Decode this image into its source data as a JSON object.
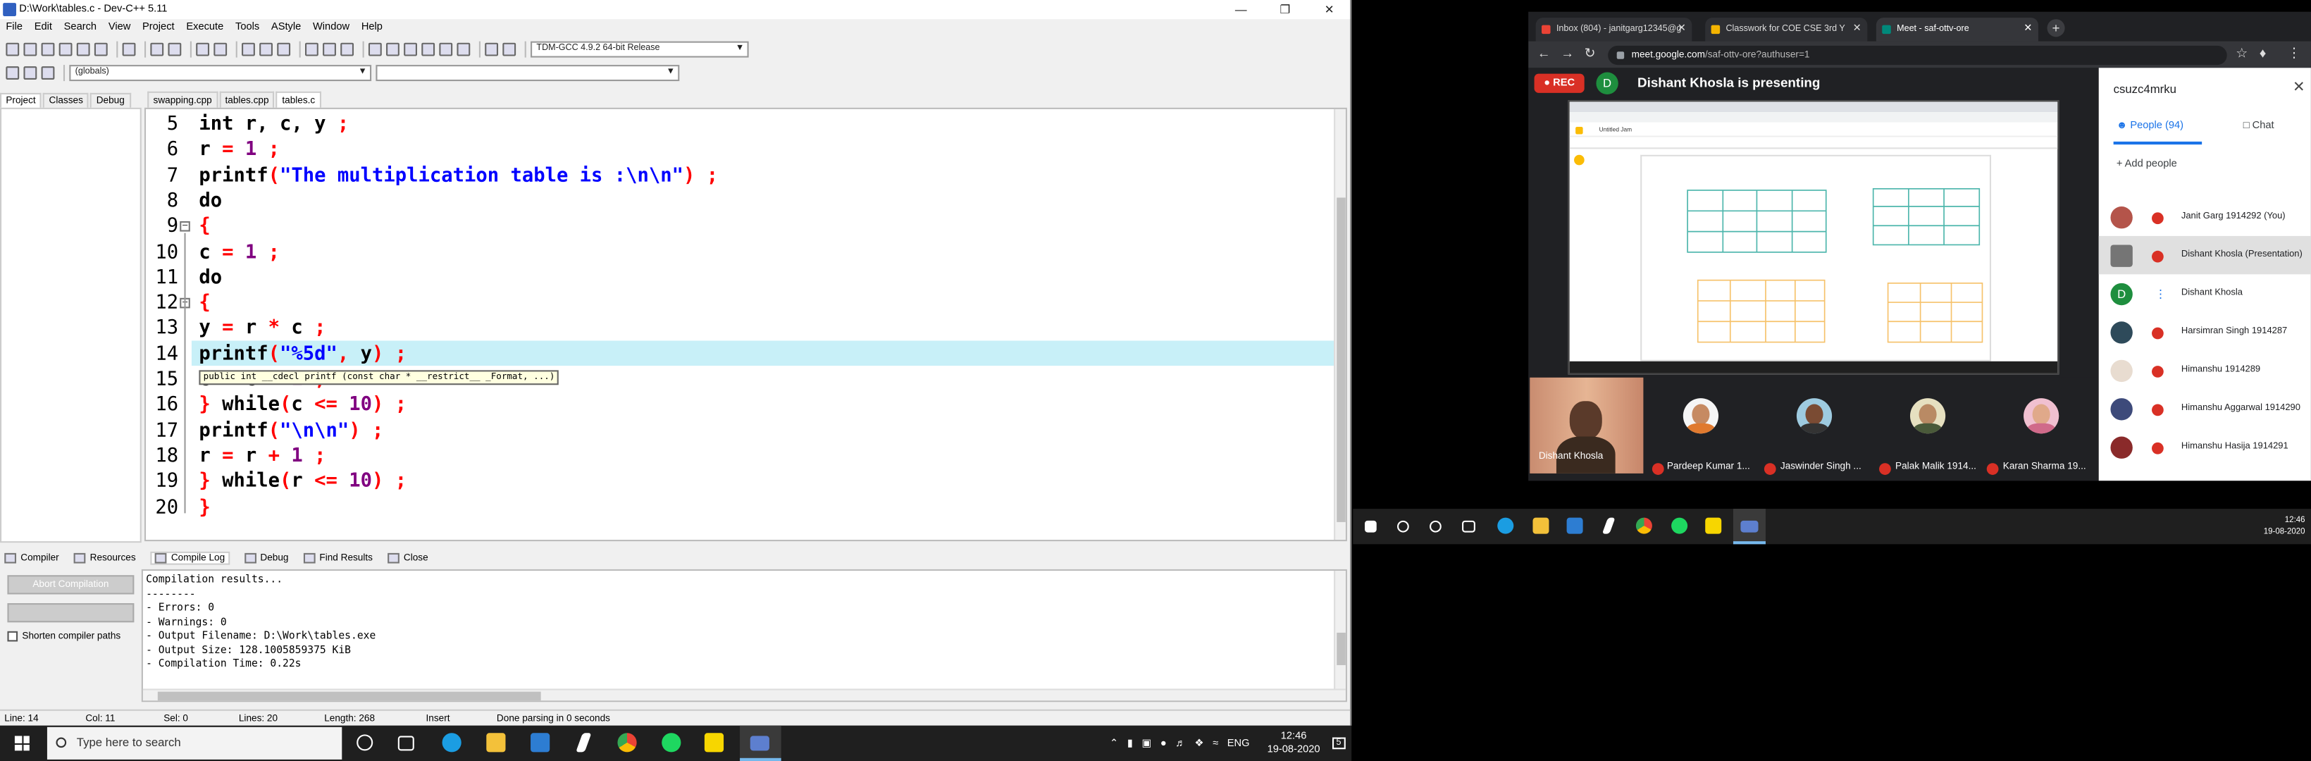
{
  "devcpp": {
    "title": "D:\\Work\\tables.c - Dev-C++ 5.11",
    "menu": [
      "File",
      "Edit",
      "Search",
      "View",
      "Project",
      "Execute",
      "Tools",
      "AStyle",
      "Window",
      "Help"
    ],
    "compiler_select": "TDM-GCC 4.9.2 64-bit Release",
    "scope_select": "(globals)",
    "left_tabs": [
      "Project",
      "Classes",
      "Debug"
    ],
    "file_tabs": [
      "swapping.cpp",
      "tables.cpp",
      "tables.c"
    ],
    "active_file_tab": "tables.c",
    "line_numbers": [
      "5",
      "6",
      "7",
      "8",
      "9",
      "10",
      "11",
      "12",
      "13",
      "14",
      "15",
      "16",
      "17",
      "18",
      "19",
      "20"
    ],
    "code_lines": [
      [
        {
          "t": "int r, c, y ",
          "c": "kw"
        },
        {
          "t": ";",
          "c": "op"
        }
      ],
      [
        {
          "t": "r ",
          "c": "kw"
        },
        {
          "t": "=",
          "c": "op"
        },
        {
          "t": " ",
          "c": "kw"
        },
        {
          "t": "1",
          "c": "num"
        },
        {
          "t": " ;",
          "c": "op"
        }
      ],
      [
        {
          "t": "printf",
          "c": "kw"
        },
        {
          "t": "(",
          "c": "op"
        },
        {
          "t": "\"The multiplication table is :\\n\\n\"",
          "c": "str"
        },
        {
          "t": ") ;",
          "c": "op"
        }
      ],
      [
        {
          "t": "do",
          "c": "kw"
        }
      ],
      [
        {
          "t": "{",
          "c": "op"
        }
      ],
      [
        {
          "t": "c ",
          "c": "kw"
        },
        {
          "t": "=",
          "c": "op"
        },
        {
          "t": " ",
          "c": "kw"
        },
        {
          "t": "1",
          "c": "num"
        },
        {
          "t": " ;",
          "c": "op"
        }
      ],
      [
        {
          "t": "do",
          "c": "kw"
        }
      ],
      [
        {
          "t": "{",
          "c": "op"
        }
      ],
      [
        {
          "t": "y ",
          "c": "kw"
        },
        {
          "t": "=",
          "c": "op"
        },
        {
          "t": " r ",
          "c": "kw"
        },
        {
          "t": "*",
          "c": "op"
        },
        {
          "t": " c ",
          "c": "kw"
        },
        {
          "t": ";",
          "c": "op"
        }
      ],
      [
        {
          "t": "printf",
          "c": "kw"
        },
        {
          "t": "(",
          "c": "op"
        },
        {
          "t": "\"%5d\"",
          "c": "str"
        },
        {
          "t": ",",
          "c": "op"
        },
        {
          "t": " y",
          "c": "kw"
        },
        {
          "t": ") ;",
          "c": "op"
        }
      ],
      [
        {
          "t": "c ",
          "c": "kw"
        },
        {
          "t": "=",
          "c": "op"
        },
        {
          "t": " c ",
          "c": "kw"
        },
        {
          "t": "+",
          "c": "op"
        },
        {
          "t": " ",
          "c": "kw"
        },
        {
          "t": "1",
          "c": "num"
        },
        {
          "t": " ;",
          "c": "op"
        }
      ],
      [
        {
          "t": "} ",
          "c": "op"
        },
        {
          "t": "while",
          "c": "kw"
        },
        {
          "t": "(",
          "c": "op"
        },
        {
          "t": "c ",
          "c": "kw"
        },
        {
          "t": "<=",
          "c": "op"
        },
        {
          "t": " ",
          "c": "kw"
        },
        {
          "t": "10",
          "c": "num"
        },
        {
          "t": ") ;",
          "c": "op"
        }
      ],
      [
        {
          "t": "printf",
          "c": "kw"
        },
        {
          "t": "(",
          "c": "op"
        },
        {
          "t": "\"\\n\\n\"",
          "c": "str"
        },
        {
          "t": ") ;",
          "c": "op"
        }
      ],
      [
        {
          "t": "r ",
          "c": "kw"
        },
        {
          "t": "=",
          "c": "op"
        },
        {
          "t": " r ",
          "c": "kw"
        },
        {
          "t": "+",
          "c": "op"
        },
        {
          "t": " ",
          "c": "kw"
        },
        {
          "t": "1",
          "c": "num"
        },
        {
          "t": " ;",
          "c": "op"
        }
      ],
      [
        {
          "t": "} ",
          "c": "op"
        },
        {
          "t": "while",
          "c": "kw"
        },
        {
          "t": "(",
          "c": "op"
        },
        {
          "t": "r ",
          "c": "kw"
        },
        {
          "t": "<=",
          "c": "op"
        },
        {
          "t": " ",
          "c": "kw"
        },
        {
          "t": "10",
          "c": "num"
        },
        {
          "t": ") ;",
          "c": "op"
        }
      ],
      [
        {
          "t": "}",
          "c": "op"
        }
      ]
    ],
    "tooltip": "public int __cdecl printf (const char * __restrict__ _Format, ...)",
    "bottom_tabs": [
      "Compiler",
      "Resources",
      "Compile Log",
      "Debug",
      "Find Results",
      "Close"
    ],
    "abort_button": "Abort Compilation",
    "shorten_paths": "Shorten compiler paths",
    "log_lines": [
      "Compilation results...",
      "--------",
      "- Errors: 0",
      "- Warnings: 0",
      "- Output Filename: D:\\Work\\tables.exe",
      "- Output Size: 128.1005859375 KiB",
      "- Compilation Time: 0.22s"
    ],
    "status": {
      "line": "Line:  14",
      "col": "Col:  11",
      "sel": "Sel:  0",
      "lines": "Lines:  20",
      "length": "Length:  268",
      "mode": "Insert",
      "msg": "Done parsing in 0 seconds"
    }
  },
  "taskbar_left": {
    "search_placeholder": "Type here to search",
    "lang": "ENG",
    "time": "12:46",
    "date": "19-08-2020",
    "notif_count": "5"
  },
  "chrome": {
    "tabs": [
      "Inbox (804) - janitgarg12345@g",
      "Classwork for COE CSE 3rd Y",
      "Meet - saf-ottv-ore"
    ],
    "url_host": "meet.google.com",
    "url_path": "/saf-ottv-ore?authuser=1",
    "rec": "REC",
    "presenter_initial": "D",
    "presenting": "Dishant Khosla is presenting",
    "shared_doc_title": "Untitled Jam",
    "self_name": "Dishant Khosla",
    "tiles": [
      "Pardeep Kumar 1...",
      "Jaswinder Singh ...",
      "Palak Malik 1914...",
      "Karan Sharma 19..."
    ]
  },
  "people_panel": {
    "user": "csuzc4mrku",
    "people_tab": "People (94)",
    "chat_tab": "Chat",
    "add_people": "Add people",
    "rows": [
      "Janit Garg 1914292 (You)",
      "Dishant Khosla (Presentation)",
      "Dishant Khosla",
      "Harsimran Singh 1914287",
      "Himanshu 1914289",
      "Himanshu Aggarwal 1914290",
      "Himanshu Hasija 1914291"
    ],
    "row_initial": "D"
  },
  "taskbar_right": {
    "time": "12:46",
    "date": "19-08-2020"
  },
  "colors": {
    "keyword": "#000000",
    "operator": "#ff0000",
    "string": "#0000ff",
    "number": "#800080",
    "current_line": "#c8f0f8",
    "rec_red": "#d93025",
    "meet_blue": "#1a73e8"
  }
}
